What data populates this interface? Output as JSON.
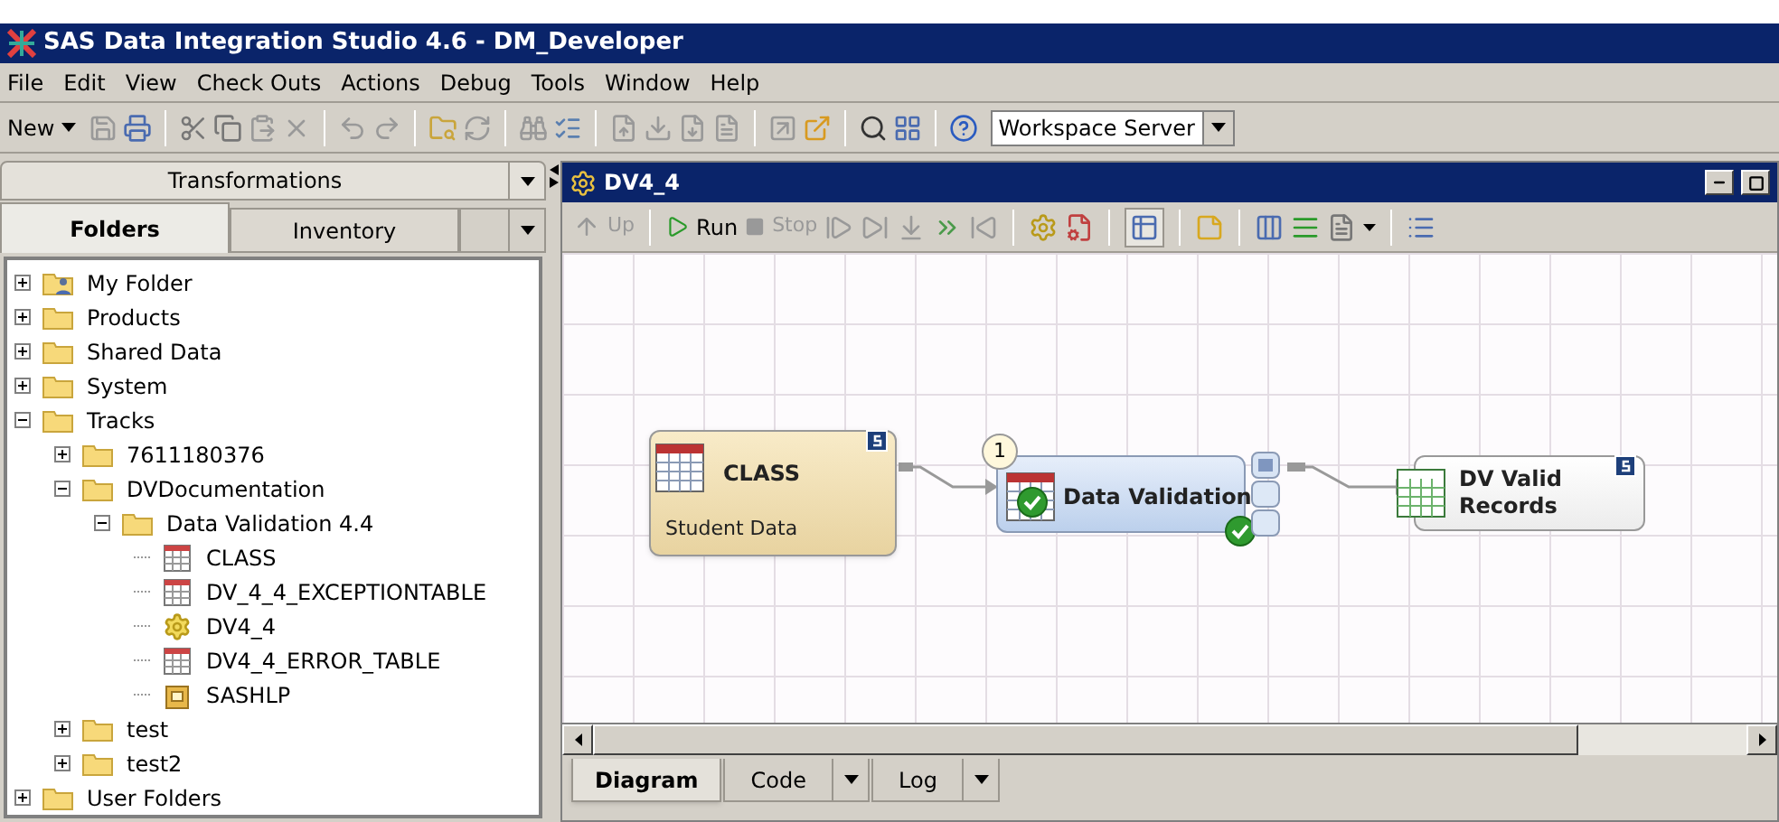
{
  "window": {
    "title": "SAS Data Integration Studio 4.6 - DM_Developer"
  },
  "menu": [
    "File",
    "Edit",
    "View",
    "Check Outs",
    "Actions",
    "Debug",
    "Tools",
    "Window",
    "Help"
  ],
  "toolbar": {
    "new_label": "New",
    "server": {
      "value": "Workspace Server"
    }
  },
  "left_panel": {
    "header": "Transformations",
    "tabs": [
      {
        "label": "Folders",
        "selected": true
      },
      {
        "label": "Inventory",
        "selected": false
      }
    ],
    "tree": [
      {
        "label": "My Folder",
        "kind": "user-folder",
        "expanded": false
      },
      {
        "label": "Products",
        "kind": "folder",
        "expanded": false
      },
      {
        "label": "Shared Data",
        "kind": "folder",
        "expanded": false
      },
      {
        "label": "System",
        "kind": "folder",
        "expanded": false
      },
      {
        "label": "Tracks",
        "kind": "folder",
        "expanded": true,
        "children": [
          {
            "label": "7611180376",
            "kind": "folder",
            "expanded": false
          },
          {
            "label": "DVDocumentation",
            "kind": "folder",
            "expanded": true,
            "children": [
              {
                "label": "Data Validation 4.4",
                "kind": "folder",
                "expanded": true,
                "children": [
                  {
                    "label": "CLASS",
                    "kind": "table"
                  },
                  {
                    "label": "DV_4_4_EXCEPTIONTABLE",
                    "kind": "table"
                  },
                  {
                    "label": "DV4_4",
                    "kind": "job"
                  },
                  {
                    "label": "DV4_4_ERROR_TABLE",
                    "kind": "table"
                  },
                  {
                    "label": "SASHLP",
                    "kind": "library"
                  }
                ]
              }
            ]
          },
          {
            "label": "test",
            "kind": "folder",
            "expanded": false
          },
          {
            "label": "test2",
            "kind": "folder",
            "expanded": false
          }
        ]
      },
      {
        "label": "User Folders",
        "kind": "folder",
        "expanded": false
      }
    ]
  },
  "job_window": {
    "title": "DV4_4",
    "toolbar": {
      "up": "Up",
      "run": "Run",
      "stop": "Stop"
    },
    "diagram": {
      "nodes": [
        {
          "kind": "source",
          "label": "CLASS",
          "sublabel": "Student Data"
        },
        {
          "kind": "transform",
          "label": "Data Validation",
          "step": "1"
        },
        {
          "kind": "target",
          "label": "DV Valid Records"
        }
      ]
    },
    "tabs": [
      {
        "label": "Diagram",
        "selected": true,
        "dropdown": false
      },
      {
        "label": "Code",
        "selected": false,
        "dropdown": true
      },
      {
        "label": "Log",
        "selected": false,
        "dropdown": true
      }
    ]
  }
}
